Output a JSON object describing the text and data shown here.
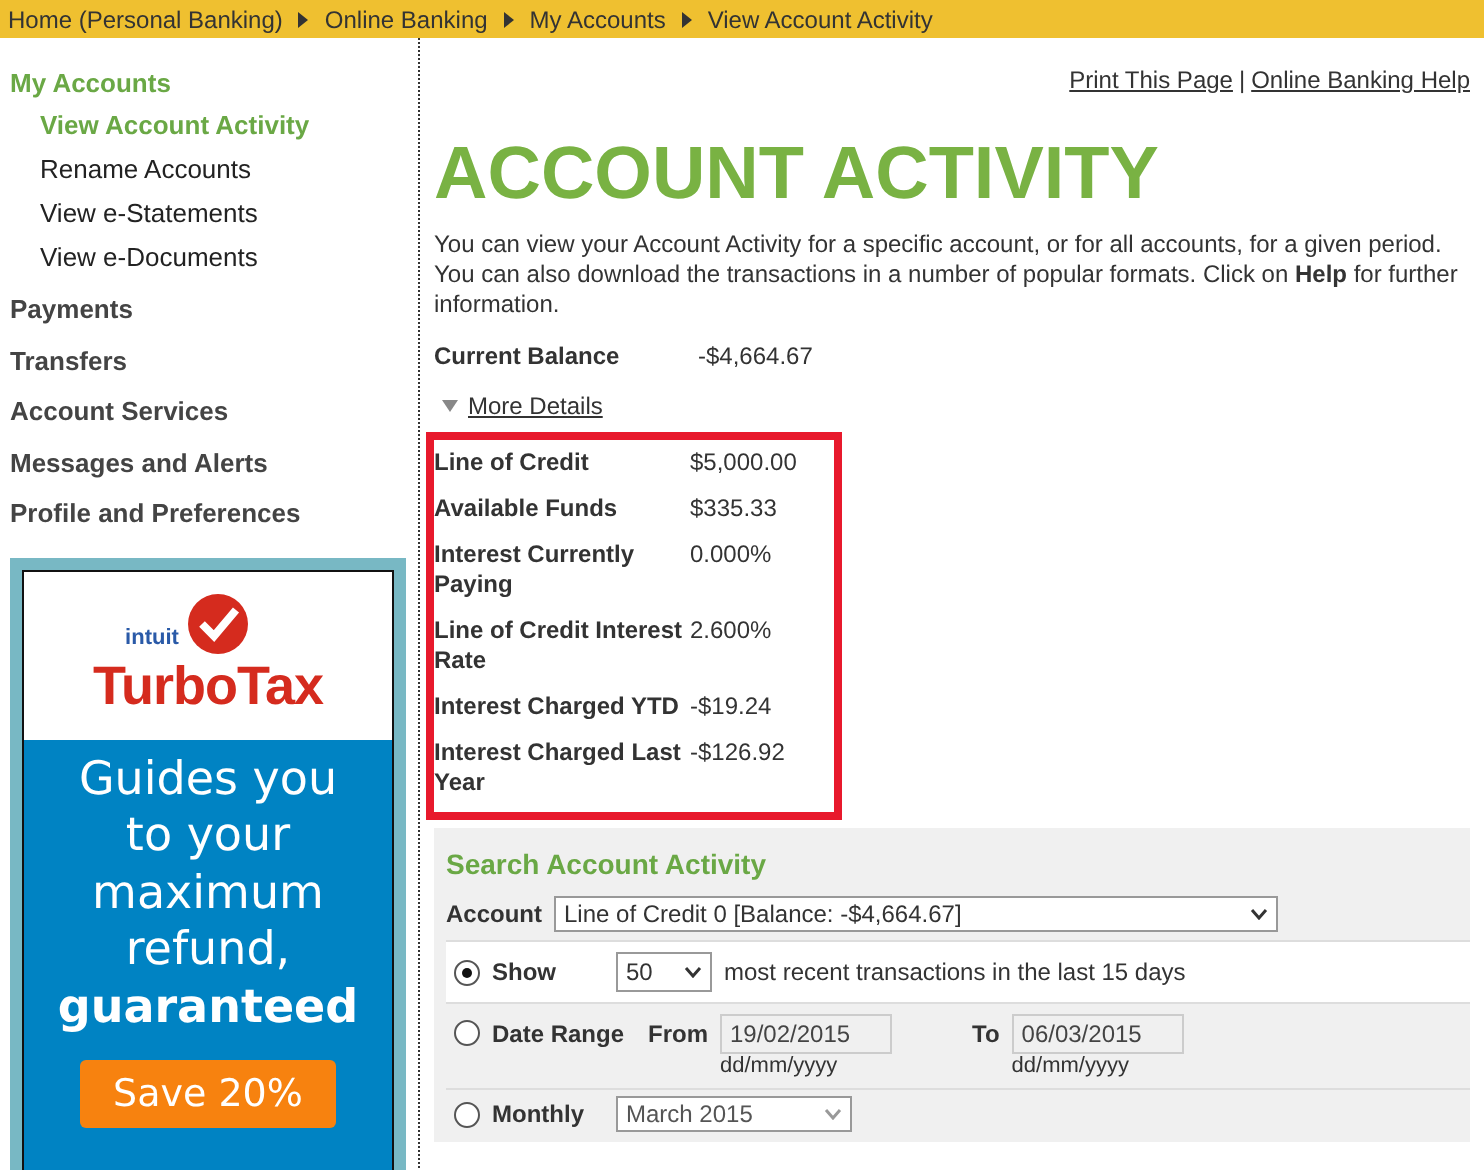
{
  "breadcrumb": [
    "Home (Personal Banking)",
    "Online Banking",
    "My Accounts",
    "View Account Activity"
  ],
  "sidebar": [
    {
      "label": "My Accounts",
      "expanded": true,
      "children": [
        {
          "label": "View Account Activity",
          "selected": true
        },
        {
          "label": "Rename Accounts",
          "selected": false
        },
        {
          "label": "View e-Statements",
          "selected": false
        },
        {
          "label": "View e-Documents",
          "selected": false
        }
      ]
    },
    {
      "label": "Payments",
      "expanded": false
    },
    {
      "label": "Transfers",
      "expanded": false
    },
    {
      "label": "Account Services",
      "expanded": false
    },
    {
      "label": "Messages and Alerts",
      "expanded": false
    },
    {
      "label": "Profile and Preferences",
      "expanded": false
    }
  ],
  "ad": {
    "brand_small": "intuit",
    "brand": "TurboTax",
    "lines": [
      "Guides you",
      "to your",
      "maximum",
      "refund,"
    ],
    "emphasis": "guaranteed",
    "button": "Save 20%"
  },
  "header_links": [
    "Print This Page",
    "Online Banking Help"
  ],
  "header_separator": "|",
  "title": "ACCOUNT ACTIVITY",
  "intro": "You can view your Account Activity for a specific account, or for all accounts, for a given period. You can also download the transactions in a number of popular formats. Click on **Help** for further information.",
  "current_balance": {
    "label": "Current Balance",
    "value": "-$4,664.67"
  },
  "more_details": {
    "label": "More Details",
    "expanded": true
  },
  "details": {
    "highlighted": true,
    "rows": [
      {
        "label": "Line of Credit",
        "value": "$5,000.00"
      },
      {
        "label": "Available Funds",
        "value": "$335.33"
      },
      {
        "label": "Interest Currently Paying",
        "value": "0.000%"
      },
      {
        "label": "Line of Credit Interest Rate",
        "value": "2.600%"
      },
      {
        "label": "Interest Charged YTD",
        "value": "-$19.24"
      },
      {
        "label": "Interest Charged Last Year",
        "value": "-$126.92"
      }
    ]
  },
  "search": {
    "title": "Search Account Activity",
    "account_label": "Account",
    "account": "Line of Credit 0 [Balance: -$4,664.67]",
    "options": [
      {
        "kind": "show",
        "selected": true,
        "label": "Show",
        "count": "50",
        "text": "most recent transactions in the last 15 days"
      },
      {
        "kind": "range",
        "selected": false,
        "label": "Date Range",
        "from_label": "From",
        "from": "19/02/2015",
        "from_hint": "dd/mm/yyyy",
        "to_label": "To",
        "to": "06/03/2015",
        "to_hint": "dd/mm/yyyy"
      },
      {
        "kind": "monthly",
        "selected": false,
        "label": "Monthly",
        "month": "March 2015"
      }
    ]
  }
}
